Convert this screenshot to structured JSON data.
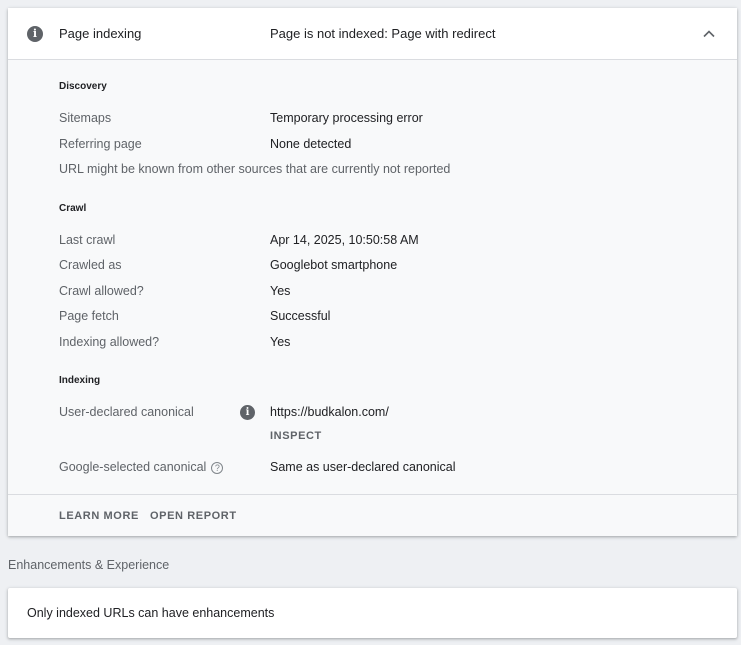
{
  "page_indexing": {
    "title": "Page indexing",
    "status": "Page is not indexed: Page with redirect",
    "info_icon": "info-icon",
    "collapse_icon": "chevron-up-icon"
  },
  "discovery": {
    "title": "Discovery",
    "rows": [
      {
        "label": "Sitemaps",
        "value": "Temporary processing error"
      },
      {
        "label": "Referring page",
        "value": "None detected"
      }
    ],
    "note": "URL might be known from other sources that are currently not reported"
  },
  "crawl": {
    "title": "Crawl",
    "rows": [
      {
        "label": "Last crawl",
        "value": "Apr 14, 2025, 10:50:58 AM"
      },
      {
        "label": "Crawled as",
        "value": "Googlebot smartphone"
      },
      {
        "label": "Crawl allowed?",
        "value": "Yes"
      },
      {
        "label": "Page fetch",
        "value": "Successful"
      },
      {
        "label": "Indexing allowed?",
        "value": "Yes"
      }
    ]
  },
  "indexing": {
    "title": "Indexing",
    "user_canonical": {
      "label": "User-declared canonical",
      "value": "https://budkalon.com/",
      "inspect_label": "INSPECT",
      "icon": "info-icon"
    },
    "google_canonical": {
      "label": "Google-selected canonical",
      "value": "Same as user-declared canonical",
      "icon": "help-icon"
    }
  },
  "footer": {
    "learn_more": "LEARN MORE",
    "open_report": "OPEN REPORT"
  },
  "enhancements": {
    "heading": "Enhancements & Experience",
    "message": "Only indexed URLs can have enhancements"
  },
  "colors": {
    "background": "#eef0f3",
    "card": "#ffffff",
    "body": "#f8f9fa",
    "label": "#5f6368",
    "text": "#202124"
  }
}
